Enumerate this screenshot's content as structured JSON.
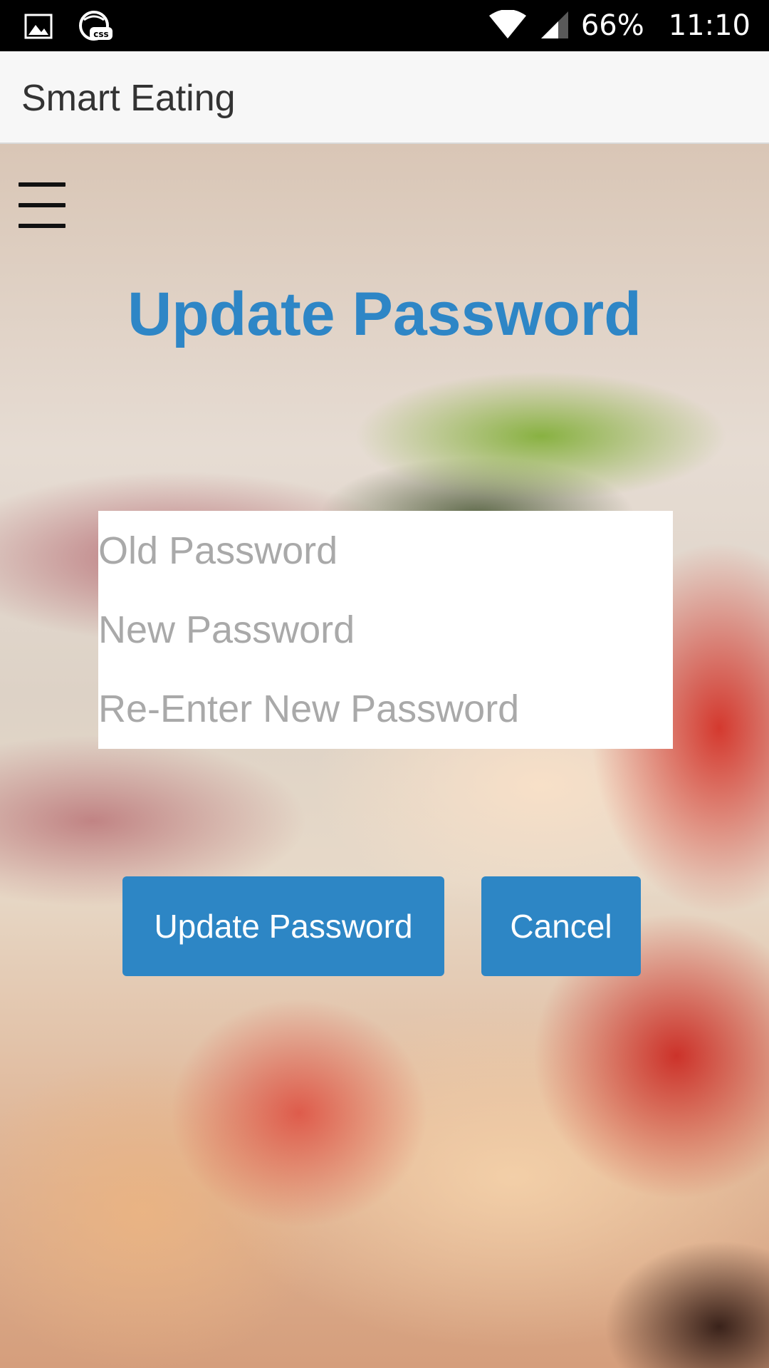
{
  "status_bar": {
    "icons": [
      "gallery-icon",
      "css-app-icon",
      "wifi-icon",
      "cell-signal-icon"
    ],
    "battery": "66%",
    "time": "11:10"
  },
  "app_bar": {
    "title": "Smart Eating"
  },
  "menu": {
    "icon": "hamburger-menu-icon"
  },
  "form": {
    "title": "Update Password",
    "old_password_placeholder": "Old Password",
    "new_password_placeholder": "New Password",
    "confirm_password_placeholder": "Re-Enter New Password"
  },
  "buttons": {
    "update_label": "Update Password",
    "cancel_label": "Cancel"
  },
  "colors": {
    "accent": "#2e86c6",
    "button": "#2d86c5",
    "app_bar": "#f7f7f7",
    "status_bar": "#000000"
  }
}
